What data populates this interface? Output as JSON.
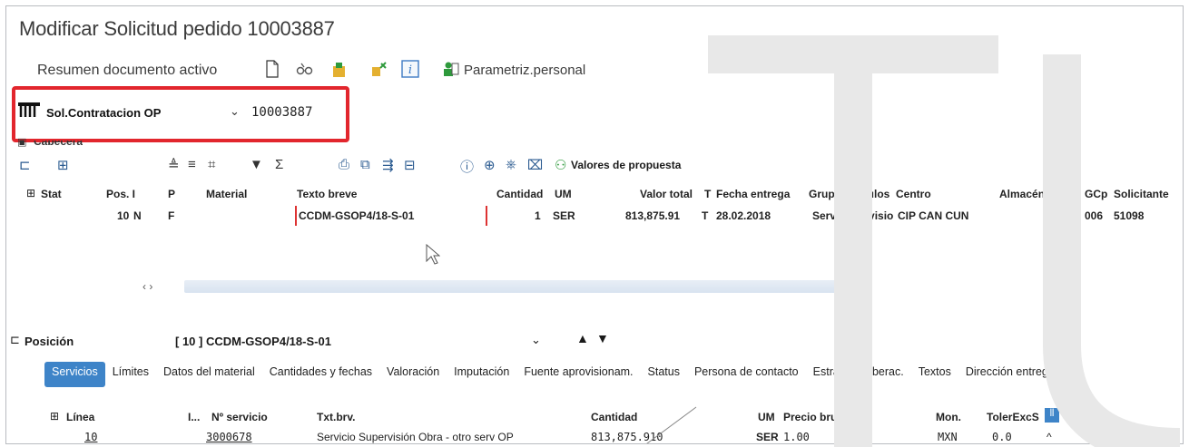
{
  "window": {
    "title": "Modificar Solicitud pedido 10003887"
  },
  "toolbar": {
    "doc_overview": "Resumen documento activo",
    "personal_settings": "Parametriz.personal"
  },
  "document": {
    "type": "Sol.Contratacion OP",
    "number": "10003887"
  },
  "header_section": {
    "label": "Cabecera"
  },
  "item_toolbar": {
    "proposal_values": "Valores de propuesta"
  },
  "items_table": {
    "columns": [
      "Stat",
      "Pos. I",
      "P",
      "Material",
      "Texto breve",
      "Cantidad",
      "UM",
      "Valor total",
      "T",
      "Fecha entrega",
      "Grupo artículos",
      "Centro",
      "Almacén",
      "GCp",
      "Solicitante"
    ],
    "row": {
      "pos": "10",
      "i": "N",
      "p": "F",
      "texto_breve": "CCDM-GSOP4/18-S-01",
      "cantidad": "1",
      "um": "SER",
      "valor_total": "813,875.91",
      "t": "T",
      "fecha_entrega": "28.02.2018",
      "grupo_articulos": "Serv supervisio",
      "centro": "CIP CAN CUN",
      "gcp": "006",
      "solicitante": "51098"
    }
  },
  "position": {
    "label": "Posición",
    "value": "[ 10 ] CCDM-GSOP4/18-S-01"
  },
  "tabs": [
    "Servicios",
    "Límites",
    "Datos del material",
    "Cantidades y fechas",
    "Valoración",
    "Imputación",
    "Fuente aprovisionam.",
    "Status",
    "Persona de contacto",
    "Estrategia liberac.",
    "Textos",
    "Dirección entreg"
  ],
  "services_table": {
    "columns": [
      "Línea",
      "I...",
      "Nº servicio",
      "Txt.brv.",
      "Cantidad",
      "UM",
      "Precio bruto",
      "Mon.",
      "TolerExcS"
    ],
    "row": {
      "linea": "10",
      "num_servicio": "3000678",
      "txt": "Servicio Supervisión Obra - otro serv OP",
      "cantidad": "813,875.910",
      "um": "SER",
      "precio": "1.00",
      "moneda": "MXN",
      "toler": "0.0",
      "extra": "^"
    }
  },
  "colors": {
    "highlight": "#e2262d",
    "active_tab": "#3e84c8",
    "watermark": "#e8e8e8"
  }
}
